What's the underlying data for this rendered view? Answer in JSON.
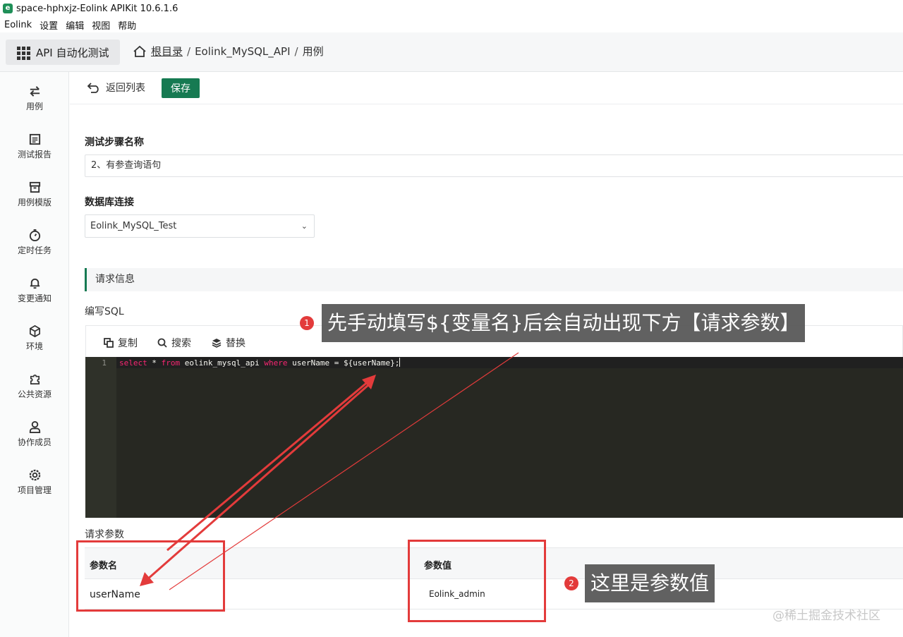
{
  "window": {
    "title": "space-hphxjz-Eolink APIKit 10.6.1.6",
    "app_icon": "e"
  },
  "menu": [
    "Eolink",
    "设置",
    "编辑",
    "视图",
    "帮助"
  ],
  "topnav": {
    "module": "API 自动化测试",
    "breadcrumb": {
      "root": "根目录",
      "sep": "/",
      "project": "Eolink_MySQL_API",
      "page": "用例"
    }
  },
  "sidebar": [
    {
      "label": "用例",
      "icon": "swap-arrows-icon"
    },
    {
      "label": "测试报告",
      "icon": "report-icon"
    },
    {
      "label": "用例模版",
      "icon": "archive-icon"
    },
    {
      "label": "定时任务",
      "icon": "timer-icon"
    },
    {
      "label": "变更通知",
      "icon": "bell-icon"
    },
    {
      "label": "环境",
      "icon": "cube-icon"
    },
    {
      "label": "公共资源",
      "icon": "puzzle-icon"
    },
    {
      "label": "协作成员",
      "icon": "user-icon"
    },
    {
      "label": "项目管理",
      "icon": "settings-icon"
    }
  ],
  "toolbar": {
    "back": "返回列表",
    "save": "保存"
  },
  "form": {
    "step_name_label": "测试步骤名称",
    "step_name_value": "2、有参查询语句",
    "db_label": "数据库连接",
    "db_value": "Eolink_MySQL_Test"
  },
  "request": {
    "section_title": "请求信息",
    "sql_label": "编写SQL",
    "tools": {
      "copy": "复制",
      "search": "搜索",
      "replace": "替换"
    },
    "code": {
      "line_number": "1",
      "kw_select": "select",
      "t1": " * ",
      "kw_from": "from",
      "t2": " eolink_mysql_api ",
      "kw_where": "where",
      "t3": " userName = ${userName};"
    },
    "params_label": "请求参数",
    "params_headers": {
      "name": "参数名",
      "value": "参数值"
    },
    "params": [
      {
        "name": "userName",
        "value": "Eolink_admin"
      }
    ]
  },
  "annotations": {
    "callout1": {
      "num": "1",
      "text": "先手动填写${变量名}后会自动出现下方【请求参数】"
    },
    "callout2": {
      "num": "2",
      "text": "这里是参数值"
    },
    "color": "#e33b3b"
  },
  "watermark": "@稀土掘金技术社区",
  "colors": {
    "accent": "#167a52",
    "editor_bg": "#272822",
    "keyword": "#f92672"
  }
}
